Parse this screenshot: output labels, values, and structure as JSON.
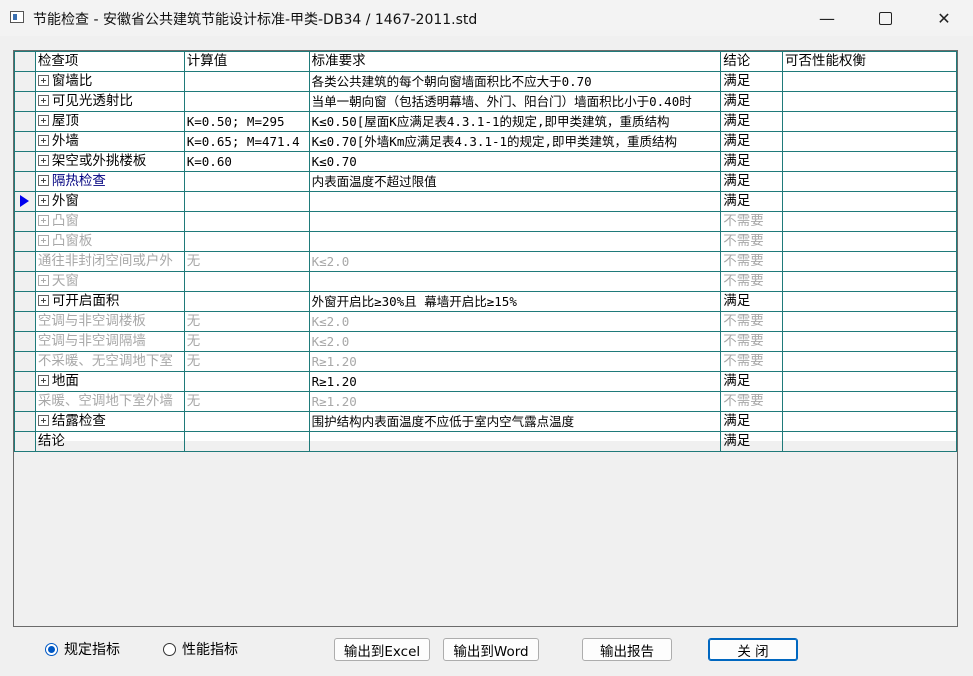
{
  "window": {
    "title": "节能检查 - 安徽省公共建筑节能设计标准-甲类-DB34 / 1467-2011.std",
    "min_glyph": "—",
    "close_glyph": "✕"
  },
  "table": {
    "headers": [
      "检查项",
      "计算值",
      "标准要求",
      "结论",
      "可否性能权衡"
    ],
    "rows": [
      {
        "item": "窗墙比",
        "value": "",
        "req": "各类公共建筑的每个朝向窗墙面积比不应大于0.70",
        "result": "满足",
        "tradeoff": ""
      },
      {
        "item": "可见光透射比",
        "value": "",
        "req": "当单一朝向窗（包括透明幕墙、外门、阳台门）墙面积比小于0.40时",
        "result": "满足",
        "tradeoff": ""
      },
      {
        "item": "屋顶",
        "value": "K=0.50; M=295",
        "req": "K≤0.50[屋面K应满足表4.3.1-1的规定,即甲类建筑，重质结构",
        "result": "满足",
        "tradeoff": ""
      },
      {
        "item": "外墙",
        "value": "K=0.65; M=471.4",
        "req": "K≤0.70[外墙Km应满足表4.3.1-1的规定,即甲类建筑，重质结构",
        "result": "满足",
        "tradeoff": ""
      },
      {
        "item": "架空或外挑楼板",
        "value": "K=0.60",
        "req": "K≤0.70",
        "result": "满足",
        "tradeoff": ""
      },
      {
        "item": "隔热检查",
        "value": "",
        "req": "内表面温度不超过限值",
        "result": "满足",
        "tradeoff": ""
      },
      {
        "item": "外窗",
        "value": "",
        "req": "",
        "result": "满足",
        "tradeoff": ""
      },
      {
        "item": "凸窗",
        "value": "",
        "req": "",
        "result": "不需要",
        "tradeoff": ""
      },
      {
        "item": "凸窗板",
        "value": "",
        "req": "",
        "result": "不需要",
        "tradeoff": ""
      },
      {
        "item": "通往非封闭空间或户外",
        "value": "无",
        "req": "K≤2.0",
        "result": "不需要",
        "tradeoff": ""
      },
      {
        "item": "天窗",
        "value": "",
        "req": "",
        "result": "不需要",
        "tradeoff": ""
      },
      {
        "item": "可开启面积",
        "value": "",
        "req": "外窗开启比≥30%且 幕墙开启比≥15%",
        "result": "满足",
        "tradeoff": ""
      },
      {
        "item": "空调与非空调楼板",
        "value": "无",
        "req": "K≤2.0",
        "result": "不需要",
        "tradeoff": ""
      },
      {
        "item": "空调与非空调隔墙",
        "value": "无",
        "req": "K≤2.0",
        "result": "不需要",
        "tradeoff": ""
      },
      {
        "item": "不采暖、无空调地下室",
        "value": "无",
        "req": "R≥1.20",
        "result": "不需要",
        "tradeoff": ""
      },
      {
        "item": "地面",
        "value": "",
        "req": "R≥1.20",
        "result": "满足",
        "tradeoff": ""
      },
      {
        "item": "采暖、空调地下室外墙",
        "value": "无",
        "req": "R≥1.20",
        "result": "不需要",
        "tradeoff": ""
      },
      {
        "item": "结露检查",
        "value": "",
        "req": "围护结构内表面温度不应低于室内空气露点温度",
        "result": "满足",
        "tradeoff": ""
      },
      {
        "item": "结论",
        "value": "",
        "req": "",
        "result": "满足",
        "tradeoff": ""
      }
    ]
  },
  "options": {
    "rule_label": "规定指标",
    "perf_label": "性能指标",
    "selected": "规定指标"
  },
  "buttons": {
    "excel": "输出到Excel",
    "word": "输出到Word",
    "report": "输出报告",
    "close": "关  闭"
  }
}
